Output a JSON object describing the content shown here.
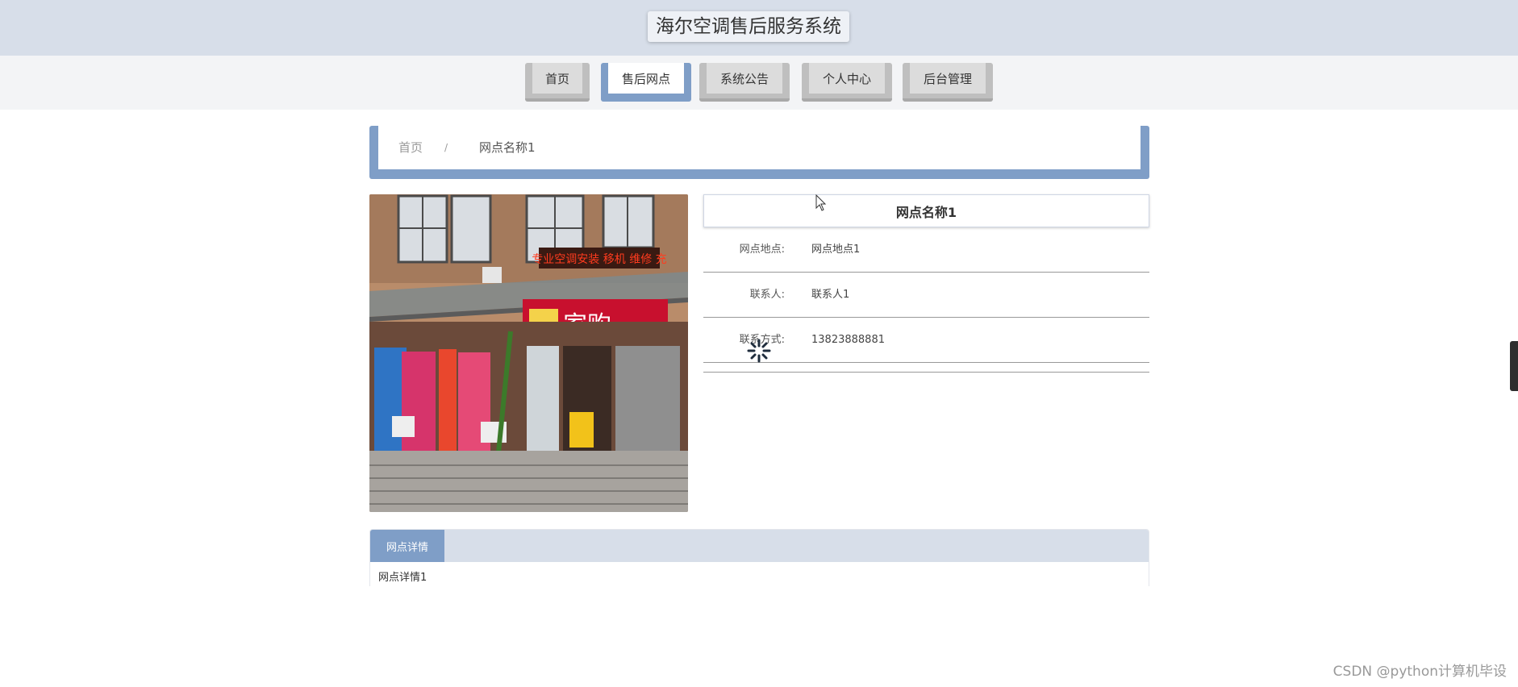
{
  "header": {
    "site_title": "海尔空调售后服务系统"
  },
  "nav": {
    "items": [
      {
        "label": "首页",
        "active": false
      },
      {
        "label": "售后网点",
        "active": true
      },
      {
        "label": "系统公告",
        "active": false
      },
      {
        "label": "个人中心",
        "active": false
      },
      {
        "label": "后台管理",
        "active": false
      }
    ]
  },
  "breadcrumb": {
    "home": "首页",
    "separator": "/",
    "current": "网点名称1"
  },
  "store": {
    "name": "网点名称1",
    "fields": [
      {
        "label": "网点地点:",
        "value": "网点地点1"
      },
      {
        "label": "联系人:",
        "value": "联系人1"
      },
      {
        "label": "联系方式:",
        "value": "13823888881"
      }
    ],
    "photo": {
      "sign_main": "家购",
      "sign_led": "专业空调安装 移机 维修 充"
    }
  },
  "detail": {
    "tab_label": "网点详情",
    "content": "网点详情1"
  },
  "watermark": "CSDN @python计算机毕设",
  "colors": {
    "accent": "#7f9ec7",
    "header_bg": "#d7dee9",
    "nav_bg": "#f3f4f6"
  }
}
